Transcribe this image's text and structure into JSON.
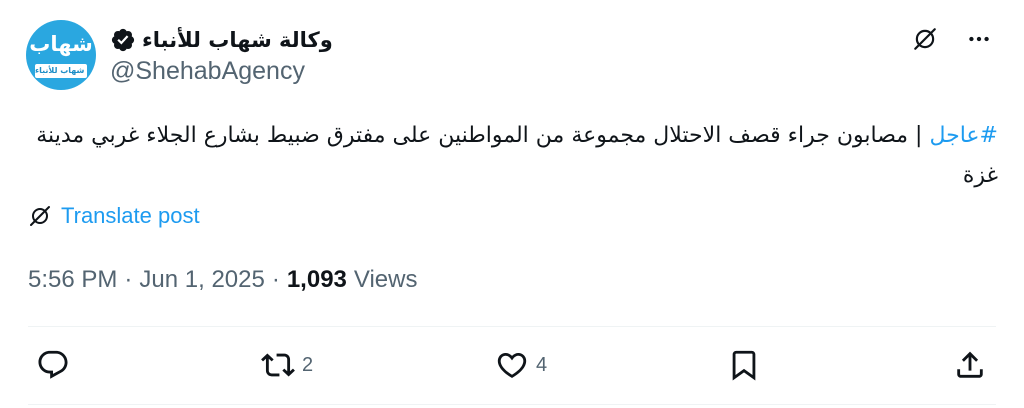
{
  "author": {
    "display_name": "وكالة شهاب للأنباء",
    "handle": "@ShehabAgency",
    "verified": true,
    "avatar_logo_main": "شهاب",
    "avatar_logo_sub": "وكالة شهاب للأنباء",
    "avatar_color": "#2aa7e0"
  },
  "post": {
    "hashtag": "#عاجل",
    "text": " | مصابون جراء قصف الاحتلال مجموعة من المواطنين على مفترق ضبيط بشارع الجلاء غربي مدينة غزة",
    "translate_label": "Translate post"
  },
  "meta": {
    "time": "5:56 PM",
    "date": "Jun 1, 2025",
    "separator": "·",
    "views_count": "1,093",
    "views_label": "Views"
  },
  "actions": {
    "reply_count": "",
    "repost_count": "2",
    "like_count": "4",
    "bookmark_count": "",
    "share_count": ""
  },
  "icons": {
    "grok": "grok-icon",
    "more": "more-icon",
    "verified": "verified-badge-icon",
    "translate": "translate-icon",
    "reply": "reply-icon",
    "repost": "repost-icon",
    "like": "heart-icon",
    "bookmark": "bookmark-icon",
    "share": "share-icon"
  },
  "colors": {
    "accent": "#1d9bf0",
    "text_primary": "#0f1419",
    "text_secondary": "#536471",
    "divider": "#eff3f4"
  }
}
